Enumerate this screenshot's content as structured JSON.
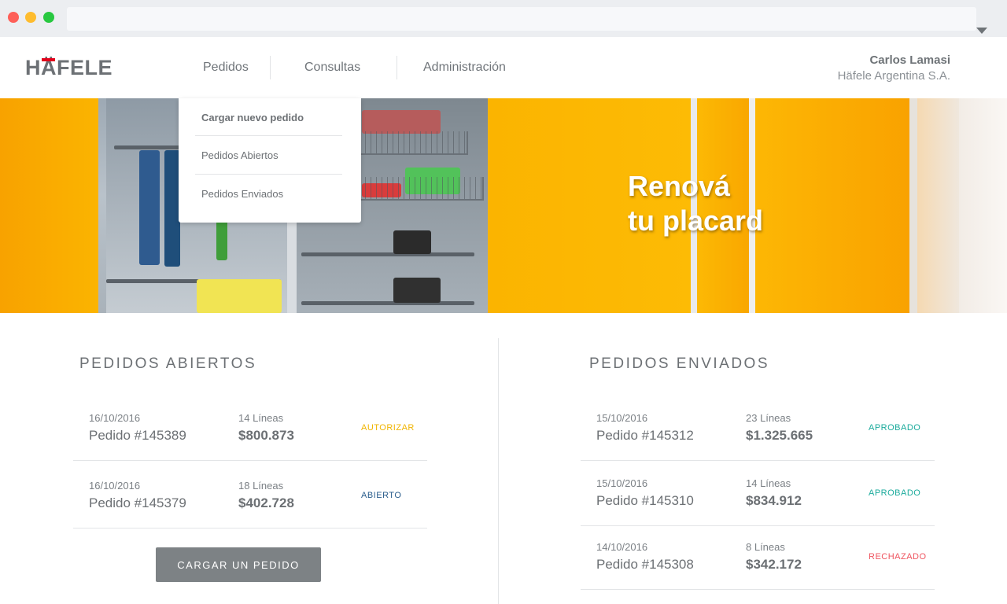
{
  "header": {
    "logo": "HÄFELE",
    "nav": [
      "Pedidos",
      "Consultas",
      "Administración"
    ],
    "user": {
      "name": "Carlos Lamasi",
      "company": "Häfele Argentina S.A."
    }
  },
  "dropdown": {
    "items": [
      "Cargar nuevo pedido",
      "Pedidos Abiertos",
      "Pedidos Enviados"
    ]
  },
  "hero": {
    "line1": "Renová",
    "line2": "tu placard"
  },
  "open_orders": {
    "title": "PEDIDOS ABIERTOS",
    "rows": [
      {
        "date": "16/10/2016",
        "order": "Pedido #145389",
        "lines": "14 Líneas",
        "amount": "$800.873",
        "status": "AUTORIZAR"
      },
      {
        "date": "16/10/2016",
        "order": "Pedido #145379",
        "lines": "18 Líneas",
        "amount": "$402.728",
        "status": "ABIERTO"
      }
    ],
    "button": "CARGAR UN PEDIDO"
  },
  "sent_orders": {
    "title": "PEDIDOS ENVIADOS",
    "rows": [
      {
        "date": "15/10/2016",
        "order": "Pedido #145312",
        "lines": "23 Líneas",
        "amount": "$1.325.665",
        "status": "APROBADO"
      },
      {
        "date": "15/10/2016",
        "order": "Pedido #145310",
        "lines": "14 Líneas",
        "amount": "$834.912",
        "status": "APROBADO"
      },
      {
        "date": "14/10/2016",
        "order": "Pedido #145308",
        "lines": "8 Líneas",
        "amount": "$342.172",
        "status": "RECHAZADO"
      }
    ]
  },
  "colors": {
    "status_autorizar": "#f0b400",
    "status_abierto": "#2a5d8c",
    "status_aprobado": "#1bab9c",
    "status_rechazado": "#ef5560",
    "brand_red": "#e2001a",
    "hero_orange": "#f9a500"
  },
  "icons": {
    "user_menu": "caret-down-icon"
  }
}
